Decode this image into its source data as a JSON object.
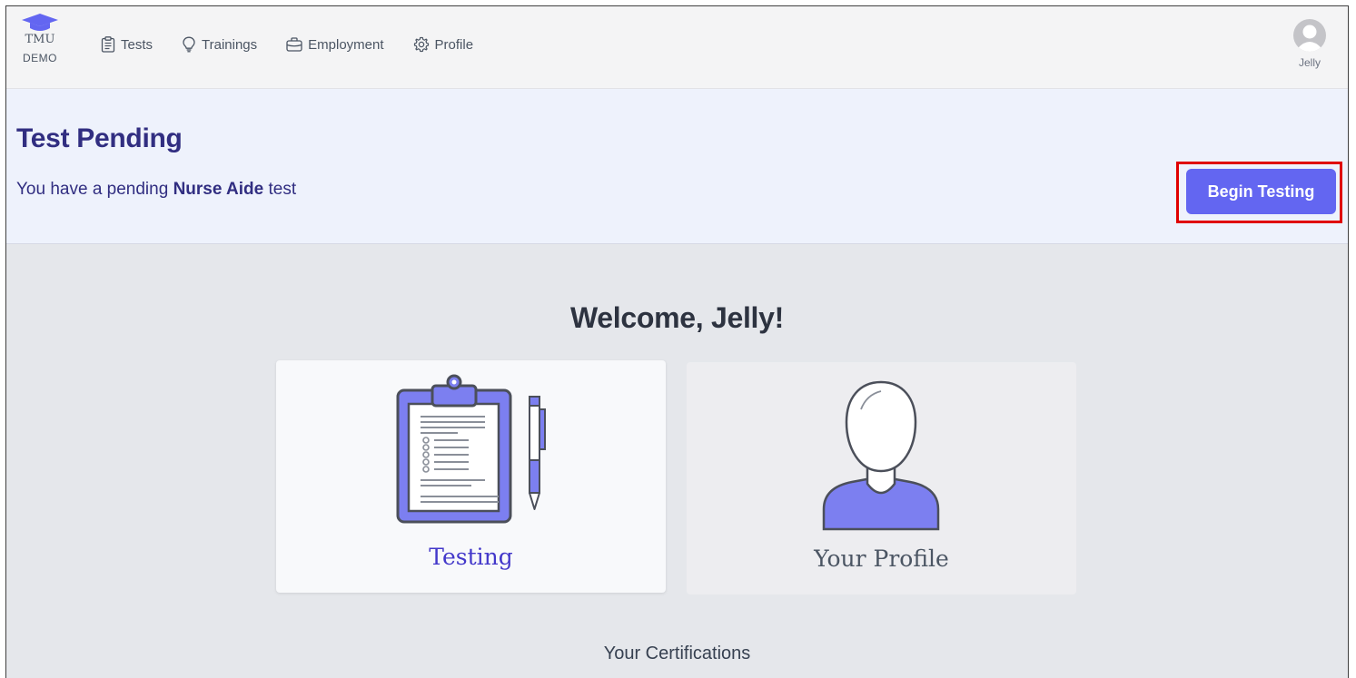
{
  "brand": {
    "name": "TMU",
    "sub": "DEMO",
    "icon": "graduation-cap-icon"
  },
  "nav": {
    "items": [
      {
        "label": "Tests",
        "icon": "clipboard-icon"
      },
      {
        "label": "Trainings",
        "icon": "lightbulb-icon"
      },
      {
        "label": "Employment",
        "icon": "briefcase-icon"
      },
      {
        "label": "Profile",
        "icon": "gear-icon"
      }
    ]
  },
  "user": {
    "name": "Jelly",
    "icon": "avatar-icon"
  },
  "banner": {
    "title": "Test Pending",
    "text_prefix": "You have a pending",
    "test_name": "Nurse Aide",
    "text_suffix": "test",
    "button_label": "Begin Testing"
  },
  "main": {
    "welcome": "Welcome, Jelly!",
    "cards": [
      {
        "label": "Testing",
        "icon": "clipboard-pen-illustration"
      },
      {
        "label": "Your Profile",
        "icon": "person-illustration"
      }
    ],
    "certifications_heading": "Your Certifications"
  },
  "colors": {
    "accent": "#6366f1",
    "title": "#312e81",
    "highlight": "#e00000"
  }
}
